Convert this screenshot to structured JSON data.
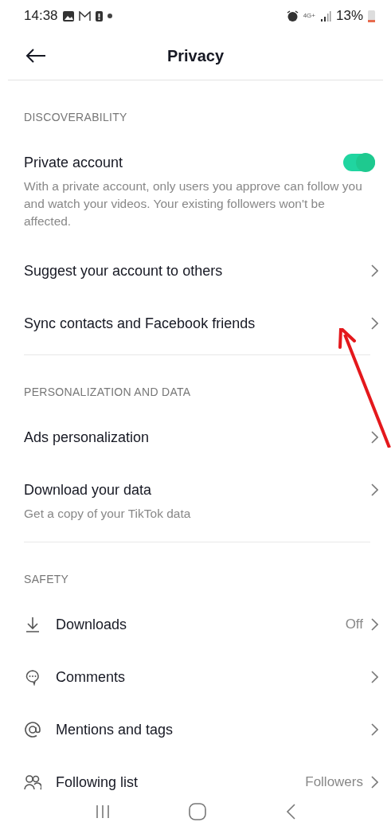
{
  "status_bar": {
    "time": "14:38",
    "network": "4G+",
    "battery": "13%"
  },
  "header": {
    "title": "Privacy"
  },
  "sections": [
    {
      "title": "DISCOVERABILITY",
      "items": [
        {
          "kind": "toggle",
          "label": "Private account",
          "on": true,
          "description": "With a private account, only users you approve can follow you and watch your videos. Your existing followers won't be affected."
        },
        {
          "kind": "link",
          "label": "Suggest your account to others"
        },
        {
          "kind": "link",
          "label": "Sync contacts and Facebook friends"
        }
      ]
    },
    {
      "title": "PERSONALIZATION AND DATA",
      "items": [
        {
          "kind": "link",
          "label": "Ads personalization"
        },
        {
          "kind": "link",
          "label": "Download your data",
          "description": "Get a copy of your TikTok data"
        }
      ]
    },
    {
      "title": "SAFETY",
      "items": [
        {
          "kind": "link",
          "label": "Downloads",
          "value": "Off"
        },
        {
          "kind": "link",
          "label": "Comments"
        },
        {
          "kind": "link",
          "label": "Mentions and tags"
        },
        {
          "kind": "link",
          "label": "Following list",
          "value": "Followers"
        }
      ]
    }
  ]
}
